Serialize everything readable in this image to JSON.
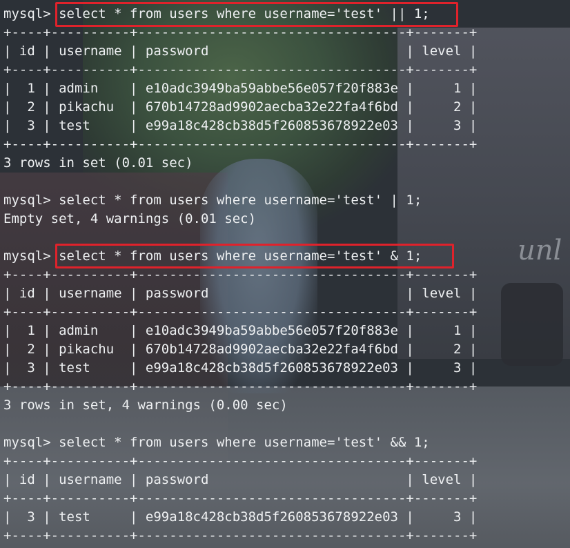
{
  "wallpaper_text": "unl",
  "colors": {
    "highlight": "#e0222b",
    "text": "#eef0f2"
  },
  "terminal": {
    "lines": [
      "mysql> select * from users where username='test' || 1;",
      "+----+----------+----------------------------------+-------+",
      "| id | username | password                         | level |",
      "+----+----------+----------------------------------+-------+",
      "|  1 | admin    | e10adc3949ba59abbe56e057f20f883e |     1 |",
      "|  2 | pikachu  | 670b14728ad9902aecba32e22fa4f6bd |     2 |",
      "|  3 | test     | e99a18c428cb38d5f260853678922e03 |     3 |",
      "+----+----------+----------------------------------+-------+",
      "3 rows in set (0.01 sec)",
      "",
      "mysql> select * from users where username='test' | 1;",
      "Empty set, 4 warnings (0.01 sec)",
      "",
      "mysql> select * from users where username='test' & 1;",
      "+----+----------+----------------------------------+-------+",
      "| id | username | password                         | level |",
      "+----+----------+----------------------------------+-------+",
      "|  1 | admin    | e10adc3949ba59abbe56e057f20f883e |     1 |",
      "|  2 | pikachu  | 670b14728ad9902aecba32e22fa4f6bd |     2 |",
      "|  3 | test     | e99a18c428cb38d5f260853678922e03 |     3 |",
      "+----+----------+----------------------------------+-------+",
      "3 rows in set, 4 warnings (0.00 sec)",
      "",
      "mysql> select * from users where username='test' && 1;",
      "+----+----------+----------------------------------+-------+",
      "| id | username | password                         | level |",
      "+----+----------+----------------------------------+-------+",
      "|  3 | test     | e99a18c428cb38d5f260853678922e03 |     3 |",
      "+----+----------+----------------------------------+-------+"
    ]
  }
}
